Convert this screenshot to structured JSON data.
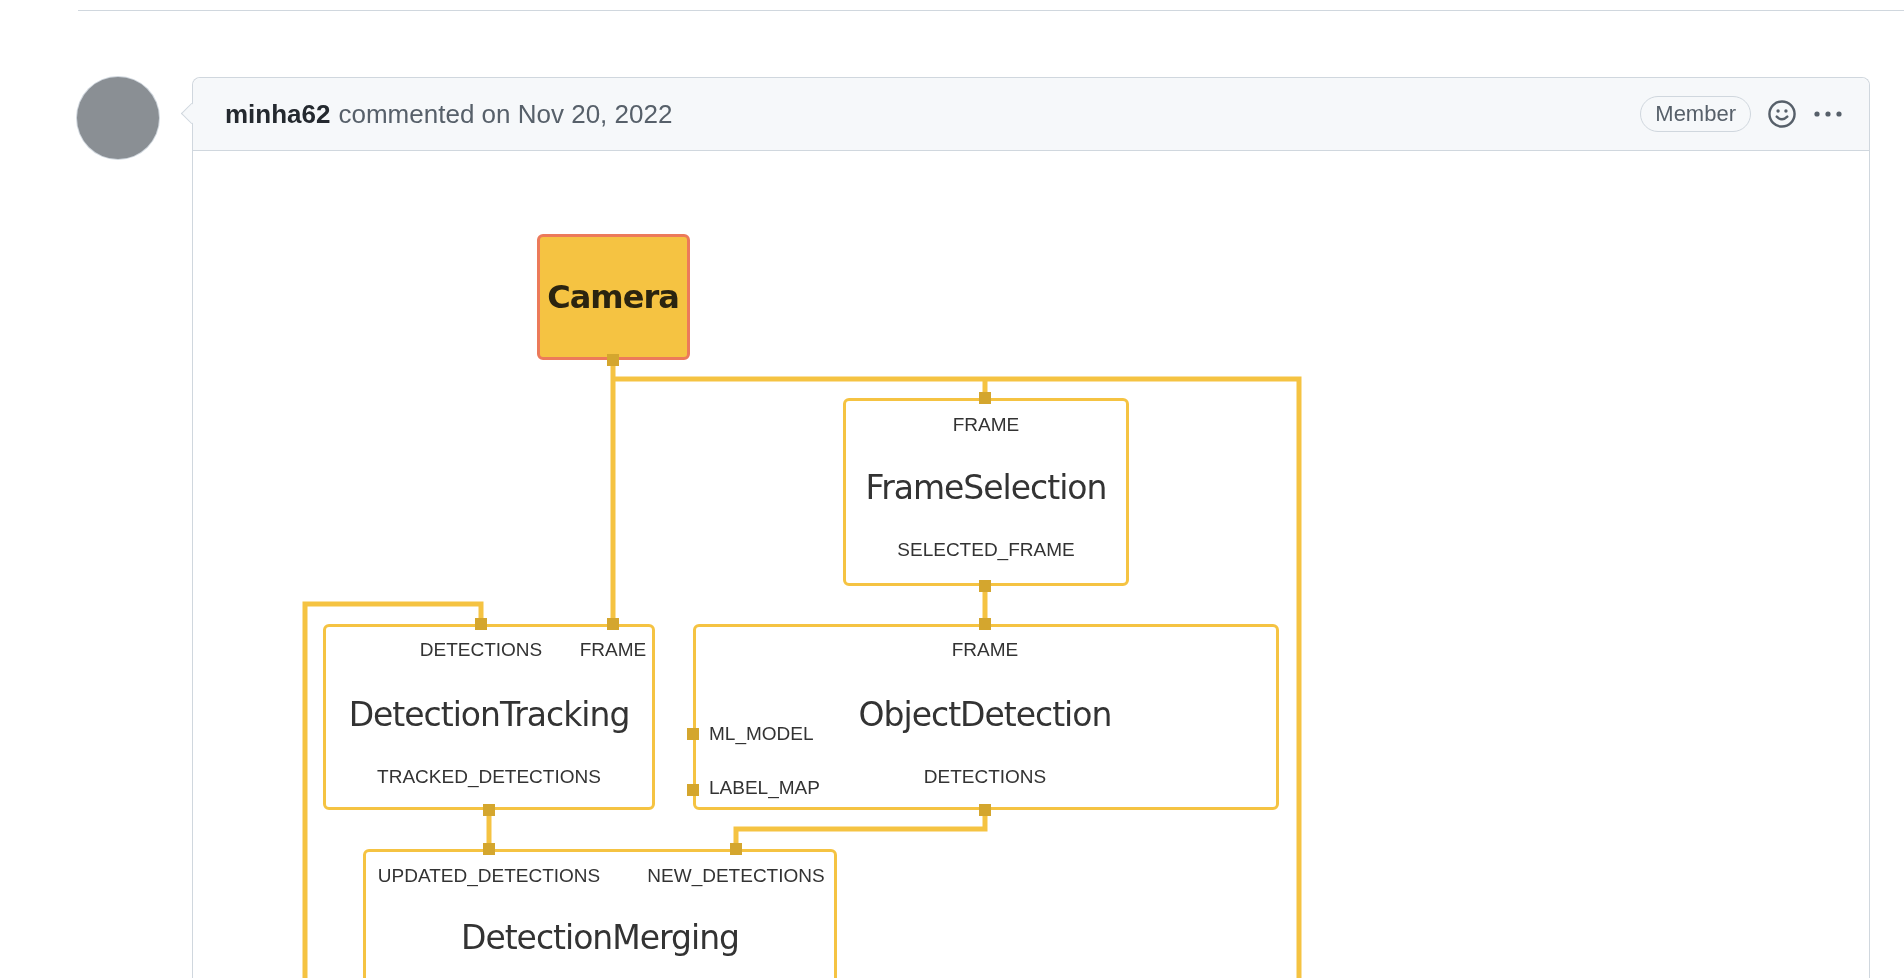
{
  "comment": {
    "author": "minha62",
    "action": "commented on Nov 20, 2022",
    "badge": "Member"
  },
  "diagram": {
    "nodes": [
      {
        "kind": "source",
        "title": "Camera"
      },
      {
        "kind": "calculator",
        "title": "FrameSelection",
        "inputs": [
          "FRAME"
        ],
        "outputs": [
          "SELECTED_FRAME"
        ]
      },
      {
        "kind": "calculator",
        "title": "DetectionTracking",
        "inputs": [
          "DETECTIONS",
          "FRAME"
        ],
        "outputs": [
          "TRACKED_DETECTIONS"
        ]
      },
      {
        "kind": "calculator",
        "title": "ObjectDetection",
        "inputs": [
          "FRAME"
        ],
        "side_inputs": [
          "ML_MODEL",
          "LABEL_MAP"
        ],
        "outputs": [
          "DETECTIONS"
        ]
      },
      {
        "kind": "calculator",
        "title": "DetectionMerging",
        "inputs": [
          "UPDATED_DETECTIONS",
          "NEW_DETECTIONS"
        ]
      }
    ]
  }
}
